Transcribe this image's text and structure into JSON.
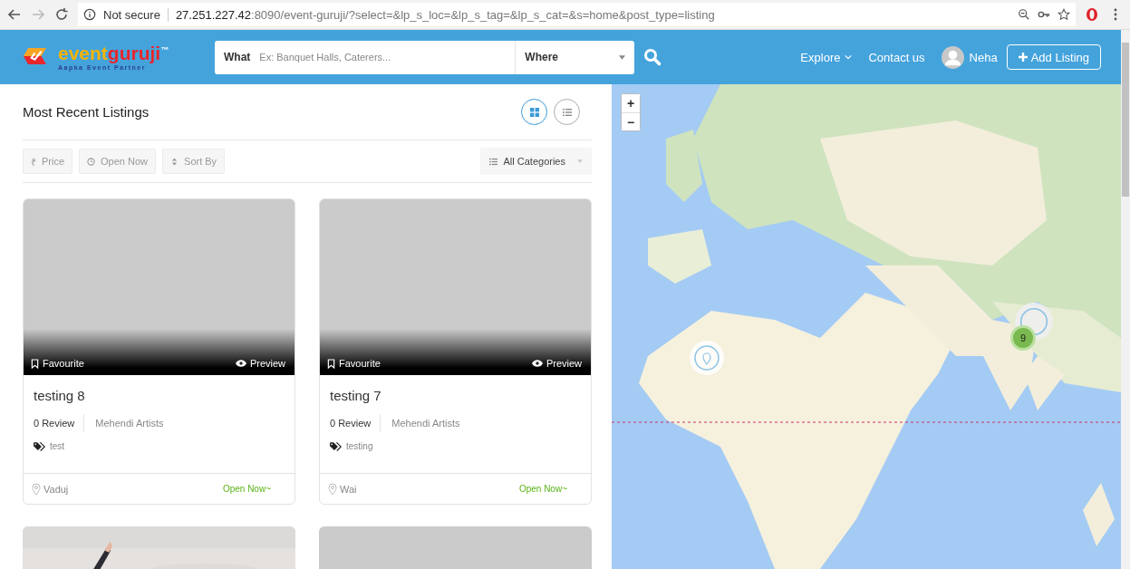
{
  "browser": {
    "security": "Not secure",
    "url_host": "27.251.227.42",
    "url_path": ":8090/event-guruji/?select=&lp_s_loc=&lp_s_tag=&lp_s_cat=&s=home&post_type=listing"
  },
  "header": {
    "logo": {
      "word_1": "event",
      "word_2": "guruji",
      "mark": "™",
      "tagline": "Aapka Event Partner"
    },
    "search": {
      "what_label": "What",
      "what_placeholder": "Ex: Banquet Halls, Caterers...",
      "where_label": "Where"
    },
    "nav": [
      {
        "label": "Explore",
        "dropdown": true
      },
      {
        "label": "Contact us",
        "dropdown": false
      }
    ],
    "user": "Neha",
    "add_button": "Add Listing"
  },
  "listings": {
    "title": "Most Recent Listings",
    "views": [
      {
        "kind": "grid",
        "selected": true
      },
      {
        "kind": "list",
        "selected": false
      }
    ],
    "filters": [
      {
        "kind": "price",
        "icon": "₹",
        "label": "Price"
      },
      {
        "kind": "clock",
        "label": "Open Now"
      },
      {
        "kind": "sort",
        "label": "Sort By"
      }
    ],
    "category": "All Categories",
    "cards": [
      {
        "favourite": "Favourite",
        "preview": "Preview",
        "title": "testing 8",
        "reviews": "0 Review",
        "category": "Mehendi Artists",
        "tag": "test",
        "location": "Vaduj",
        "status": "Open Now~"
      },
      {
        "favourite": "Favourite",
        "preview": "Preview",
        "title": "testing 7",
        "reviews": "0 Review",
        "category": "Mehendi Artists",
        "tag": "testing",
        "location": "Wai",
        "status": "Open Now~"
      }
    ],
    "more_cards": [
      {
        "kind": "picture"
      },
      {
        "kind": "blank"
      }
    ]
  },
  "map": {
    "zoom_in": "+",
    "zoom_out": "−",
    "markers": [
      {
        "kind": "pin"
      },
      {
        "kind": "cluster",
        "count": "9"
      }
    ]
  }
}
